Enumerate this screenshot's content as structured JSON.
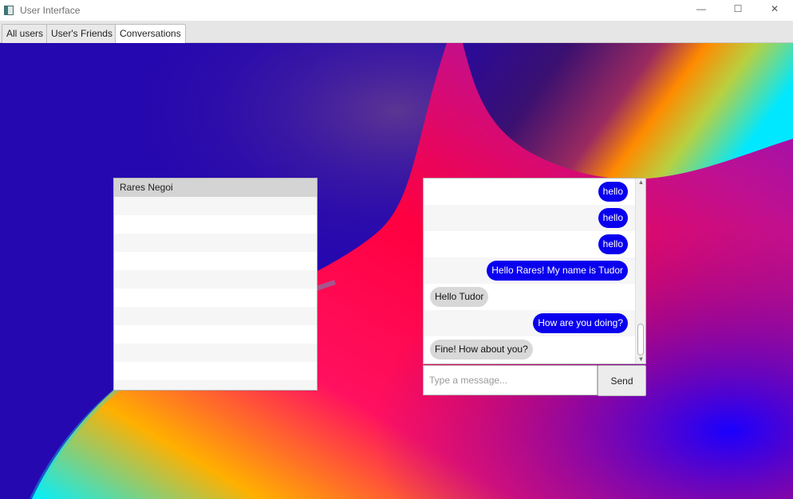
{
  "window": {
    "title": "User Interface",
    "controls": {
      "minimize": "—",
      "maximize": "☐",
      "close": "✕"
    }
  },
  "tabs": [
    {
      "label": "All users",
      "active": false
    },
    {
      "label": "User's Friends",
      "active": false
    },
    {
      "label": "Conversations",
      "active": true
    }
  ],
  "conversations": {
    "items": [
      "Rares Negoi",
      "",
      "",
      "",
      "",
      "",
      "",
      "",
      "",
      "",
      "",
      ""
    ]
  },
  "chat": {
    "messages": [
      {
        "text": "hello",
        "from": "me"
      },
      {
        "text": "hello",
        "from": "me"
      },
      {
        "text": "hello",
        "from": "me"
      },
      {
        "text": "Hello Rares! My name is Tudor",
        "from": "me"
      },
      {
        "text": "Hello Tudor",
        "from": "other"
      },
      {
        "text": "How are you doing?",
        "from": "me"
      },
      {
        "text": "Fine! How about you?",
        "from": "other"
      }
    ],
    "input_placeholder": "Type a message...",
    "send_label": "Send"
  },
  "colors": {
    "sent_bubble": "#0a00ee",
    "received_bubble": "#d8d8d8",
    "wallpaper_base": "#2608b0"
  },
  "icons": {
    "app": "app-window-icon",
    "minimize": "minimize-icon",
    "maximize": "maximize-icon",
    "close": "close-icon"
  }
}
